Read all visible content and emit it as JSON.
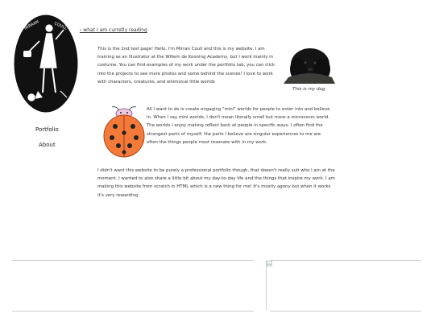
{
  "logo": {
    "line1": "MIRRAN",
    "line2": "COULL"
  },
  "nav": {
    "portfolio": "Portfolio",
    "about": "About"
  },
  "reading_link": "› what I am curretly reading",
  "intro": {
    "paragraph1": "This is the 2nd test page! Hello, I'm Mirran Coull and this is my website. I am training as an Illustrator at the Willem de Kooning Academy, but I work mainly in costume. You can find examples of my work under the portfolio tab, you can click into the projects to see more photos and some behind the scenes! I love to work with characters, creatures, and whimsical little worlds",
    "dog_caption": "This is my dog",
    "paragraph2": "All I want to do is create engaging \"mini\" worlds for people to enter into and believe in. When I say mini worlds, I don't mean literally small but more a microcosm world. The worlds I enjoy making reflect back at people in specific ways. I often find the strangest parts of myself; the parts I believe are singular experiences to me are often the things people most resonate with in my work.",
    "paragraph3": "I didn't want this website to be purely a professional portfolio though, that doesn't really suit who I am at the moment. I wanted to also share a little bit about my day-to-day life and the things that inspire my work. I am making this website from scratch in HTML which is a new thing for me! It's mostly agony but when it works it's very rewarding."
  }
}
